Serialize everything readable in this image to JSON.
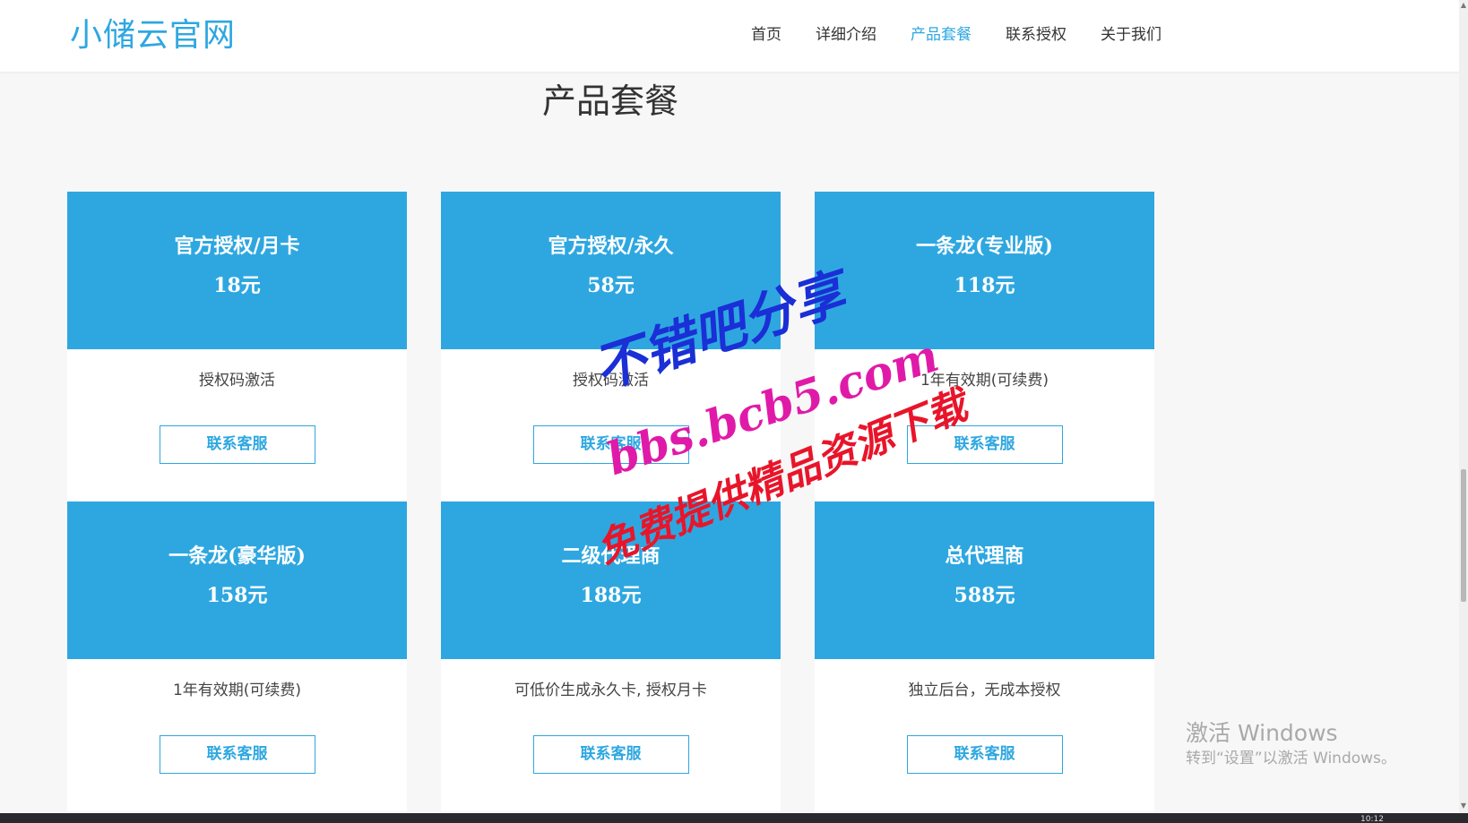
{
  "site": {
    "logo": "小储云官网"
  },
  "nav": {
    "items": [
      {
        "label": "首页",
        "active": false
      },
      {
        "label": "详细介绍",
        "active": false
      },
      {
        "label": "产品套餐",
        "active": true
      },
      {
        "label": "联系授权",
        "active": false
      },
      {
        "label": "关于我们",
        "active": false
      }
    ]
  },
  "section": {
    "title": "产品套餐"
  },
  "cards": [
    {
      "name": "官方授权/月卡",
      "price": "18元",
      "desc": "授权码激活",
      "button": "联系客服"
    },
    {
      "name": "官方授权/永久",
      "price": "58元",
      "desc": "授权码激活",
      "button": "联系客服"
    },
    {
      "name": "一条龙(专业版)",
      "price": "118元",
      "desc": "1年有效期(可续费)",
      "button": "联系客服"
    },
    {
      "name": "一条龙(豪华版)",
      "price": "158元",
      "desc": "1年有效期(可续费)",
      "button": "联系客服"
    },
    {
      "name": "二级代理商",
      "price": "188元",
      "desc": "可低价生成永久卡, 授权月卡",
      "button": "联系客服"
    },
    {
      "name": "总代理商",
      "price": "588元",
      "desc": "独立后台，无成本授权",
      "button": "联系客服"
    }
  ],
  "watermark": {
    "line1": "不错吧分享",
    "line2": "bbs.bcb5.com",
    "line3": "免费提供精品资源下载"
  },
  "os_overlay": {
    "title": "激活 Windows",
    "subtitle": "转到“设置”以激活 Windows。",
    "clock": "10:12"
  },
  "colors": {
    "accent": "#2ea7e0",
    "card_bg": "#ffffff",
    "page_bg": "#f7f7f7"
  }
}
